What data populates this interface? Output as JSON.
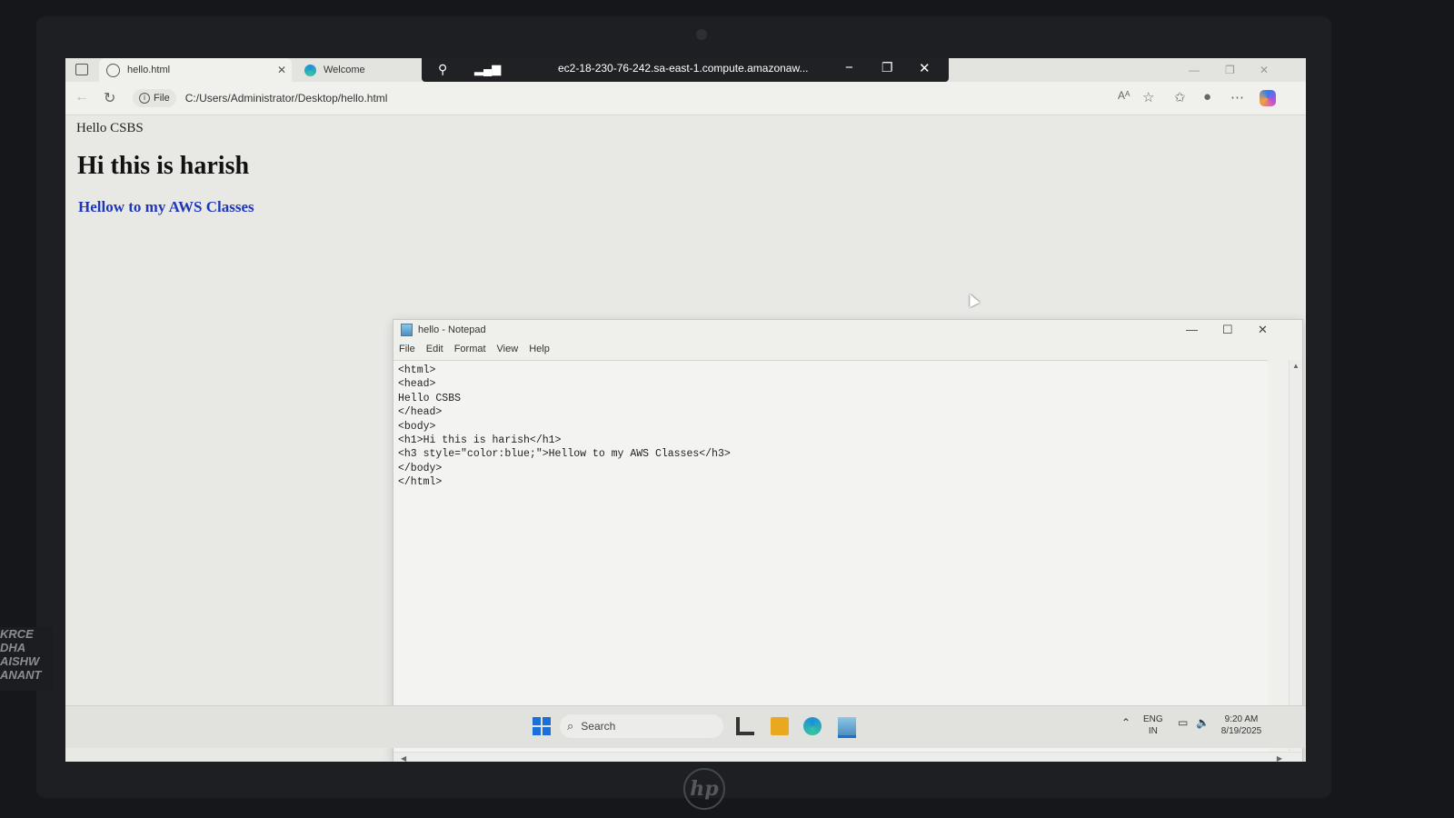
{
  "browser": {
    "tabs": [
      {
        "label": "hello.html",
        "active": true
      },
      {
        "label": "Welcome",
        "active": false
      }
    ],
    "address_badge": "File",
    "address_url": "C:/Users/Administrator/Desktop/hello.html",
    "read_aloud_label": "Aᴬ"
  },
  "rdp_bar": {
    "host": "ec2-18-230-76-242.sa-east-1.compute.amazonaw..."
  },
  "page": {
    "text": "Hello CSBS",
    "h1": "Hi this is harish",
    "h3": "Hellow to my AWS Classes",
    "h3_color": "#2038b8"
  },
  "notepad": {
    "title": "hello - Notepad",
    "menu": [
      "File",
      "Edit",
      "Format",
      "View",
      "Help"
    ],
    "lines": [
      "<html>",
      "<head>",
      "Hello CSBS",
      "</head>",
      "<body>",
      "<h1>Hi this is harish</h1>",
      "<h3 style=\"color:blue;\">Hellow to my AWS Classes</h3>",
      "</body>",
      "</html>"
    ]
  },
  "taskbar": {
    "search_label": "Search",
    "lang_top": "ENG",
    "lang_bottom": "IN",
    "time": "9:20 AM",
    "date": "8/19/2025"
  },
  "device": {
    "brand": "hp",
    "sticker_lines": [
      "KRCE",
      "DHA",
      "AISHW",
      "ANANT"
    ]
  },
  "colors": {
    "accent": "#1a6fd8",
    "rdp_bar_bg": "#202124"
  }
}
